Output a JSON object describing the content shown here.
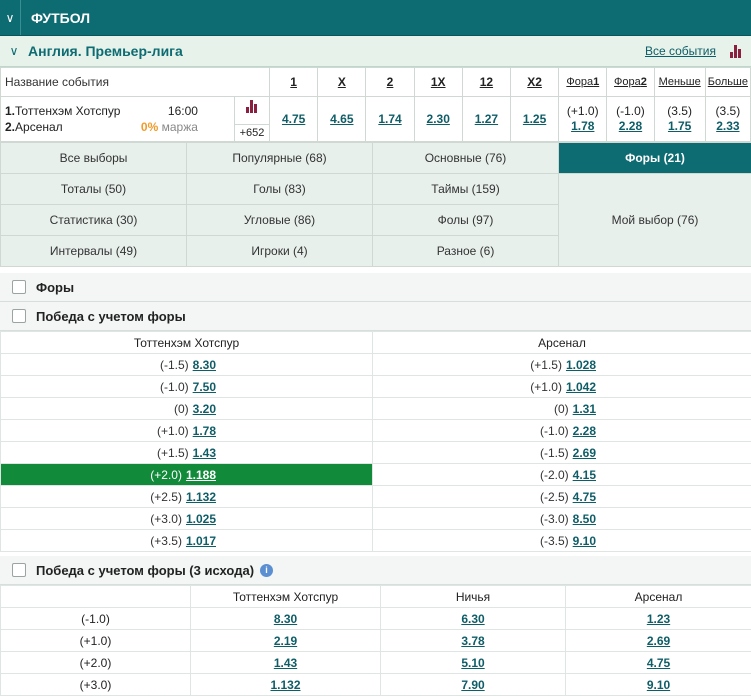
{
  "sport": "ФУТБОЛ",
  "league": {
    "title": "Англия. Премьер-лига",
    "all_events": "Все события"
  },
  "event_header": {
    "name_col": "Название события",
    "cols": [
      "1",
      "X",
      "2",
      "1X",
      "12",
      "X2"
    ],
    "split_cols": [
      {
        "text": "Фора",
        "bold": "1"
      },
      {
        "text": "Фора",
        "bold": "2"
      },
      {
        "text": "Меньше",
        "bold": ""
      },
      {
        "text": "Больше",
        "bold": ""
      }
    ]
  },
  "event": {
    "team1_num": "1.",
    "team1": "Тоттенхэм Хотспур",
    "team2_num": "2.",
    "team2": "Арсенал",
    "time": "16:00",
    "margin_val": "0%",
    "margin_label": "маржа",
    "more": "+652",
    "odds": [
      "4.75",
      "4.65",
      "1.74",
      "2.30",
      "1.27",
      "1.25"
    ],
    "fora1_hc": "(+1.0)",
    "fora1_odd": "1.78",
    "fora2_hc": "(-1.0)",
    "fora2_odd": "2.28",
    "under_hc": "(3.5)",
    "under_odd": "1.75",
    "over_hc": "(3.5)",
    "over_odd": "2.33"
  },
  "tabs": {
    "all": "Все выборы",
    "popular": "Популярные (68)",
    "main": "Основные (76)",
    "fora": "Форы (21)",
    "totals": "Тоталы (50)",
    "goals": "Голы (83)",
    "halves": "Таймы (159)",
    "stats": "Статистика (30)",
    "corners": "Угловые (86)",
    "fouls": "Фолы (97)",
    "mychoice": "Мой выбор (76)",
    "intervals": "Интервалы (49)",
    "players": "Игроки (4)",
    "misc": "Разное (6)"
  },
  "section_fory": "Форы",
  "section_handicap": "Победа с учетом форы",
  "handicap_table": {
    "team1": "Тоттенхэм Хотспур",
    "team2": "Арсенал",
    "rows": [
      {
        "h1": "(-1.5)",
        "o1": "8.30",
        "h2": "(+1.5)",
        "o2": "1.028"
      },
      {
        "h1": "(-1.0)",
        "o1": "7.50",
        "h2": "(+1.0)",
        "o2": "1.042"
      },
      {
        "h1": "(0)",
        "o1": "3.20",
        "h2": "(0)",
        "o2": "1.31"
      },
      {
        "h1": "(+1.0)",
        "o1": "1.78",
        "h2": "(-1.0)",
        "o2": "2.28"
      },
      {
        "h1": "(+1.5)",
        "o1": "1.43",
        "h2": "(-1.5)",
        "o2": "2.69"
      },
      {
        "h1": "(+2.0)",
        "o1": "1.188",
        "h2": "(-2.0)",
        "o2": "4.15"
      },
      {
        "h1": "(+2.5)",
        "o1": "1.132",
        "h2": "(-2.5)",
        "o2": "4.75"
      },
      {
        "h1": "(+3.0)",
        "o1": "1.025",
        "h2": "(-3.0)",
        "o2": "8.50"
      },
      {
        "h1": "(+3.5)",
        "o1": "1.017",
        "h2": "(-3.5)",
        "o2": "9.10"
      }
    ]
  },
  "section_handicap3": "Победа с учетом форы (3 исхода)",
  "handicap3_table": {
    "col1": "Тоттенхэм Хотспур",
    "col2": "Ничья",
    "col3": "Арсенал",
    "rows": [
      {
        "h": "(-1.0)",
        "a": "8.30",
        "b": "6.30",
        "c": "1.23"
      },
      {
        "h": "(+1.0)",
        "a": "2.19",
        "b": "3.78",
        "c": "2.69"
      },
      {
        "h": "(+2.0)",
        "a": "1.43",
        "b": "5.10",
        "c": "4.75"
      },
      {
        "h": "(+3.0)",
        "a": "1.132",
        "b": "7.90",
        "c": "9.10"
      }
    ]
  },
  "colors": {
    "header": "#0d6b72",
    "selected": "#118a3a",
    "link": "#0e5d67",
    "margin": "#f09c2c"
  }
}
